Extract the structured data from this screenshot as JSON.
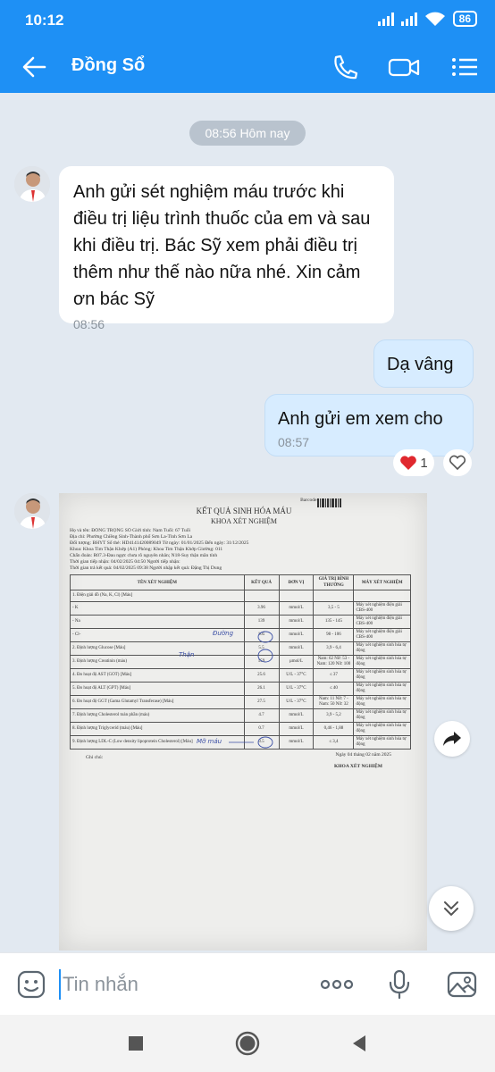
{
  "status_bar": {
    "time": "10:12",
    "battery": "86"
  },
  "header": {
    "title": "Đồng Sổ"
  },
  "chat": {
    "date_chip": "08:56 Hôm nay",
    "messages": [
      {
        "text": "Anh gửi sét nghiệm máu trước khi điều trị liệu trình thuốc của em và sau khi điều trị. Bác Sỹ xem phải điều trị thêm như thế nào nữa nhé. Xin cảm ơn bác Sỹ",
        "time": "08:56"
      },
      {
        "text": "Dạ vâng"
      },
      {
        "text": "Anh gửi em xem cho",
        "time": "08:57"
      }
    ],
    "reaction": {
      "count": "1"
    }
  },
  "document": {
    "barcode_label": "Barcode:",
    "title": "KẾT QUẢ SINH HÓA MÁU",
    "subtitle": "KHOA XÉT NGHIỆM",
    "info_lines": [
      "Họ và tên:  ĐỒNG TRỌNG SỔ          Giới tính: Nam          Tuổi: 67 Tuổi",
      "Địa chỉ:  Phường Chiềng Sinh-Thành phố Sơn La-Tỉnh Sơn La",
      "Đối tượng:  BHYT          Số thẻ: HD4141420089049          Từ ngày: 01/01/2025   Đến ngày: 31/12/2025",
      "Khoa:  Khoa Tim Thận Khớp (A1)          Phòng: Khoa Tim Thận Khớp          Giường: 011",
      "Chẩn đoán: R07.3-Đau ngực chưa rõ nguyên nhân; N18-Suy thận mãn tính",
      "Thời gian tiếp nhận:  04/02/2025 04:50          Người tiếp nhận:",
      "Thời gian trả kết quả:  04/02/2025 09:38          Người nhập kết quả: Đặng Thị Dung"
    ],
    "headers": [
      "TÊN XÉT NGHIỆM",
      "KẾT QUẢ",
      "ĐƠN VỊ",
      "GIÁ TRỊ BÌNH THƯỜNG",
      "MÁY XÉT NGHIỆM"
    ],
    "rows": [
      [
        "1. Điện giải đồ (Na, K, Cl) [Máu]",
        "",
        "",
        "",
        ""
      ],
      [
        "- K",
        "3.96",
        "mmol/L",
        "3,5 - 5",
        "Máy xét nghiệm điện giải CBS-400"
      ],
      [
        "- Na",
        "139",
        "mmol/L",
        "135 - 145",
        "Máy xét nghiệm điện giải CBS-400"
      ],
      [
        "- Cl-",
        "105",
        "mmol/L",
        "98 - 106",
        "Máy xét nghiệm điện giải CBS-400"
      ],
      [
        "2. Định lượng Glucose [Máu]",
        "5.5",
        "mmol/L",
        "3,9 - 6,4",
        "Máy xét nghiệm sinh hóa tự động"
      ],
      [
        "3. Định lượng Creatinin (máu)",
        "159",
        "µmol/L",
        "Nam: 62 Nữ: 53 - Nam: 120 Nữ: 100",
        "Máy xét nghiệm sinh hóa tự động"
      ],
      [
        "4. Đo hoạt độ AST (GOT) [Máu]",
        "25.6",
        "U/L - 37°C",
        "≤ 37",
        "Máy xét nghiệm sinh hóa tự động"
      ],
      [
        "5. Đo hoạt độ ALT (GPT) [Máu]",
        "26.1",
        "U/L - 37°C",
        "≤ 40",
        "Máy xét nghiệm sinh hóa tự động"
      ],
      [
        "6. Đo hoạt độ GGT (Gama Glutamyl Transferase) [Máu]",
        "27.5",
        "U/L - 37°C",
        "Nam: 11  Nữ: 7 - Nam: 50  Nữ: 32",
        "Máy xét nghiệm sinh hóa tự động"
      ],
      [
        "7. Định lượng Cholesterol toàn phần (máu)",
        "4.7",
        "mmol/L",
        "3,9 - 5,2",
        "Máy xét nghiệm sinh hóa tự động"
      ],
      [
        "8. Định lượng Triglycerid (máu) [Máu]",
        "0.7",
        "mmol/L",
        "0,46 - 1,88",
        "Máy xét nghiệm sinh hóa tự động"
      ],
      [
        "9. Định lượng LDL-C (Low density lipoprotein Cholesterol) [Máu]",
        "3.5",
        "mmol/L",
        "≤ 3,4",
        "Máy xét nghiệm sinh hóa tự động"
      ]
    ],
    "footer_date": "Ngày 04 tháng 02 năm 2025",
    "footer_dept": "KHOA XÉT NGHIỆM",
    "footnote": "Ghi chú:",
    "handwriting": [
      "Đường",
      "Thận",
      "Mỡ máu"
    ]
  },
  "input": {
    "placeholder": "Tin nhắn"
  }
}
